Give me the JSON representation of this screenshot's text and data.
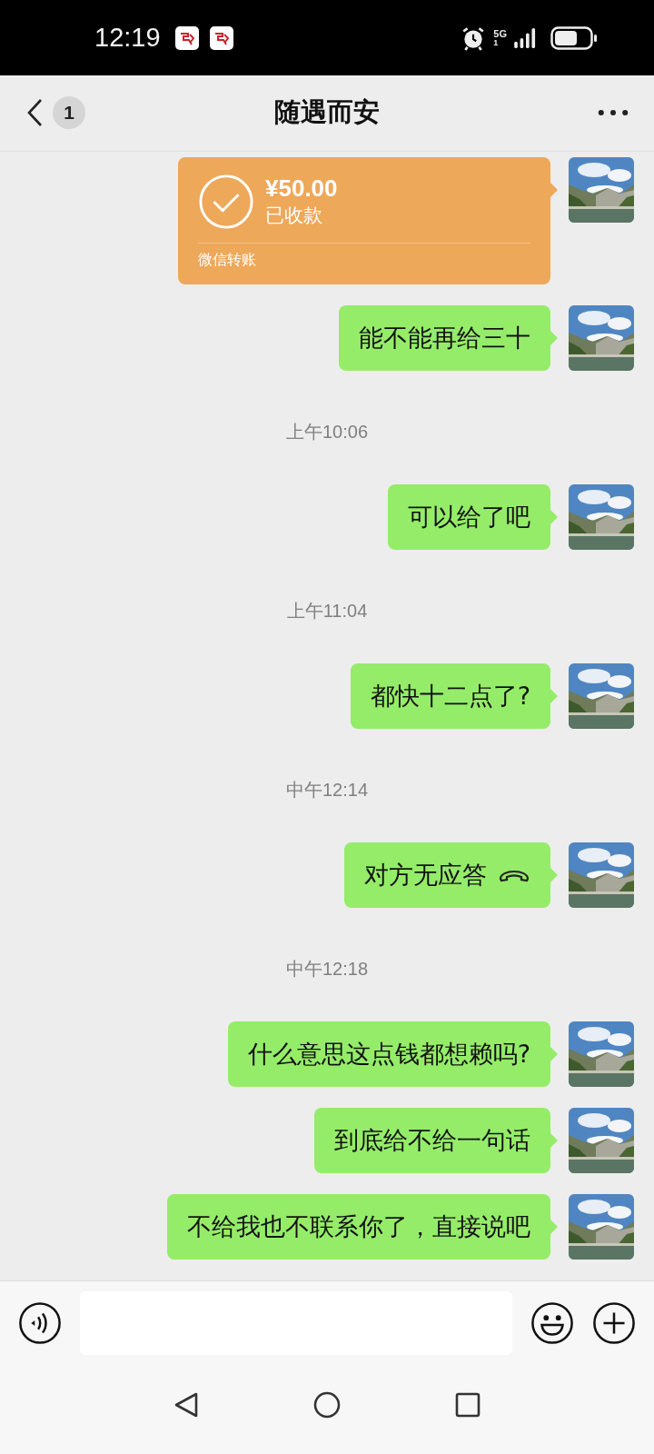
{
  "status_bar": {
    "time": "12:19",
    "network": "5G",
    "sim": "1"
  },
  "header": {
    "unread_count": "1",
    "title": "随遇而安"
  },
  "messages": [
    {
      "kind": "transfer",
      "amount": "¥50.00",
      "status": "已收款",
      "footer": "微信转账"
    },
    {
      "kind": "text",
      "text": "能不能再给三十"
    },
    {
      "kind": "time",
      "text": "上午10:06"
    },
    {
      "kind": "text",
      "text": "可以给了吧"
    },
    {
      "kind": "time",
      "text": "上午11:04"
    },
    {
      "kind": "text",
      "text": "都快十二点了?"
    },
    {
      "kind": "time",
      "text": "中午12:14"
    },
    {
      "kind": "call",
      "text": "对方无应答"
    },
    {
      "kind": "time",
      "text": "中午12:18"
    },
    {
      "kind": "text",
      "text": "什么意思这点钱都想赖吗?"
    },
    {
      "kind": "text",
      "text": "到底给不给一句话"
    },
    {
      "kind": "text",
      "text": "不给我也不联系你了，直接说吧"
    }
  ]
}
